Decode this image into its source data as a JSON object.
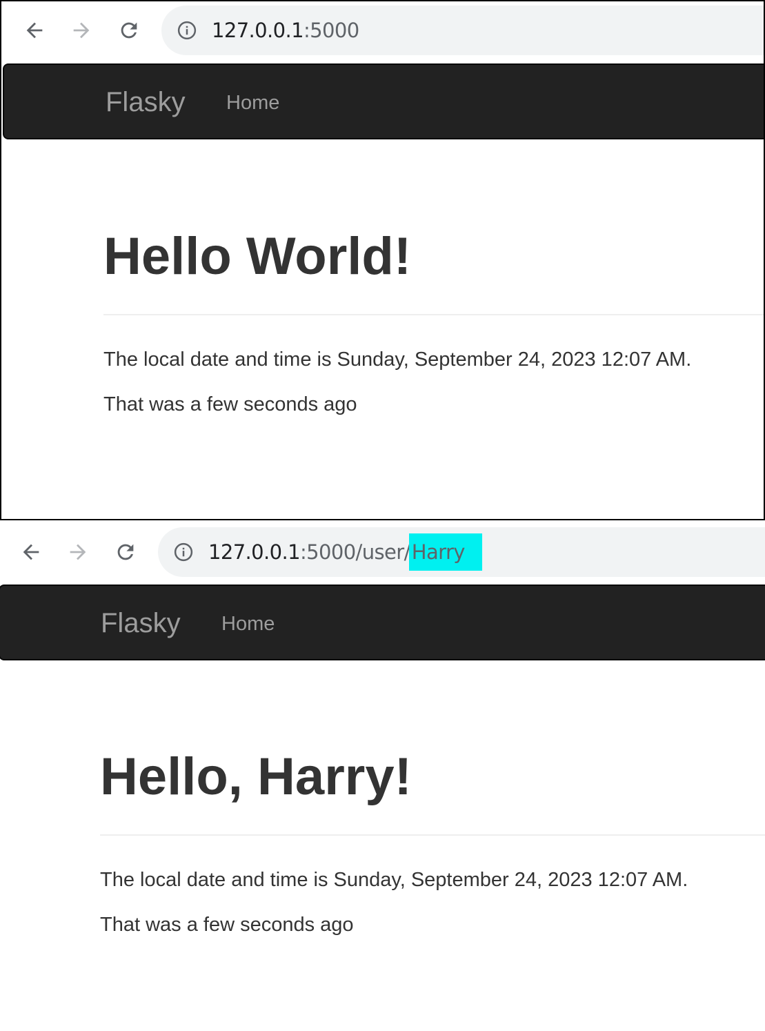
{
  "screenshots": [
    {
      "url": {
        "host": "127.0.0.1",
        "rest": ":5000"
      },
      "navbar": {
        "brand": "Flasky",
        "links": [
          "Home"
        ]
      },
      "heading": "Hello World!",
      "local_time": "The local date and time is Sunday, September 24, 2023 12:07 AM.",
      "relative_time": "That was a few seconds ago"
    },
    {
      "url": {
        "host": "127.0.0.1",
        "rest": ":5000/user/",
        "highlight": "Harry"
      },
      "navbar": {
        "brand": "Flasky",
        "links": [
          "Home"
        ]
      },
      "heading": "Hello, Harry!",
      "local_time": "The local date and time is Sunday, September 24, 2023 12:07 AM.",
      "relative_time": "That was a few seconds ago"
    }
  ],
  "colors": {
    "navbar_bg": "#222222",
    "navbar_text": "#9d9d9d",
    "highlight": "#00f0f0",
    "text": "#333333"
  },
  "icons": [
    "back-arrow-icon",
    "forward-arrow-icon",
    "reload-icon",
    "info-icon"
  ]
}
